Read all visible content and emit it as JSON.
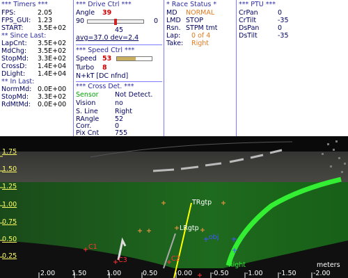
{
  "timers": {
    "title": "*** Timers ***",
    "rows": [
      {
        "label": "FPS:",
        "value": "2.05"
      },
      {
        "label": "FPS_GUI:",
        "value": "1.23"
      },
      {
        "label": "START:",
        "value": "3.5E+02"
      }
    ],
    "since_title": "** Since Last:",
    "since_rows": [
      {
        "label": "LapCnt:",
        "value": "3.5E+02"
      },
      {
        "label": "MdChg:",
        "value": "3.5E+02"
      },
      {
        "label": "StopMd:",
        "value": "3.3E+02"
      },
      {
        "label": "CrossD:",
        "value": "1.4E+04"
      },
      {
        "label": "DLight:",
        "value": "1.4E+04"
      }
    ],
    "in_title": "** In Last:",
    "in_rows": [
      {
        "label": "NormMd:",
        "value": "0.0E+00"
      },
      {
        "label": "StopMd:",
        "value": "3.3E+02"
      },
      {
        "label": "RdMtMd:",
        "value": "0.0E+00"
      }
    ]
  },
  "drive": {
    "title": "***  Drive Ctrl  ***",
    "angle_label": "Angle",
    "angle_value": "39",
    "slider_min": "90",
    "slider_max": "0",
    "slider_level": 0.5,
    "slider_mid": "45",
    "stats": "avg=37.0  dev=2.4",
    "speed_title": "***  Speed Ctrl  ***",
    "speed_label": "Speed",
    "speed_value": "53",
    "speed_level": 0.53,
    "turbo_label": "Turbo",
    "turbo_value": "8",
    "nkt": "N+kT [DC nfnd]",
    "cross_title": "*** Cross Det. ***",
    "cross_rows": [
      {
        "label": "Sensor",
        "value": "Not Detect."
      },
      {
        "label": "Vision",
        "value": "no"
      },
      {
        "label": "S. Line",
        "value": "Right"
      },
      {
        "label": "RAngle",
        "value": "52"
      },
      {
        "label": "Corr.",
        "value": "0"
      },
      {
        "label": "Pix Cnt",
        "value": "755"
      }
    ]
  },
  "race": {
    "title": "* Race Status *",
    "rows": [
      {
        "label": "MD",
        "value": "NORMAL"
      },
      {
        "label": "LMD",
        "value": "STOP"
      },
      {
        "label": "Rsn.",
        "value": "STPM tmt"
      },
      {
        "label": "Lap:",
        "value": "0 of 4"
      },
      {
        "label": "Take:",
        "value": "Right"
      }
    ]
  },
  "ptu": {
    "title": "*** PTU ***",
    "rows": [
      {
        "label": "CrPan",
        "value": "0"
      },
      {
        "label": "CrTilt",
        "value": "-35"
      },
      {
        "label": "DsPan",
        "value": "0"
      },
      {
        "label": "DsTilt",
        "value": "-35"
      }
    ]
  },
  "camera": {
    "y_labels": [
      "1.75",
      "1.50",
      "1.25",
      "1.00",
      "0.75",
      "0.50",
      "0.25"
    ],
    "x_labels": [
      "2.00",
      "1.50",
      "1.00",
      "0.50",
      "0.00",
      "-0.50",
      "-1.00",
      "-1.50",
      "-2.00"
    ],
    "units": "meters",
    "markers": {
      "trgtp": "TRgtp",
      "lrgtp": "LRgtp",
      "right": "Right",
      "obj": "obj",
      "c1": "C1",
      "c3": "C3",
      "c2": "C2"
    },
    "colors": {
      "grid_text": "#ffff66",
      "road": "#1a6a1a",
      "lane": "#33ee33",
      "target": "#ffff00"
    }
  }
}
